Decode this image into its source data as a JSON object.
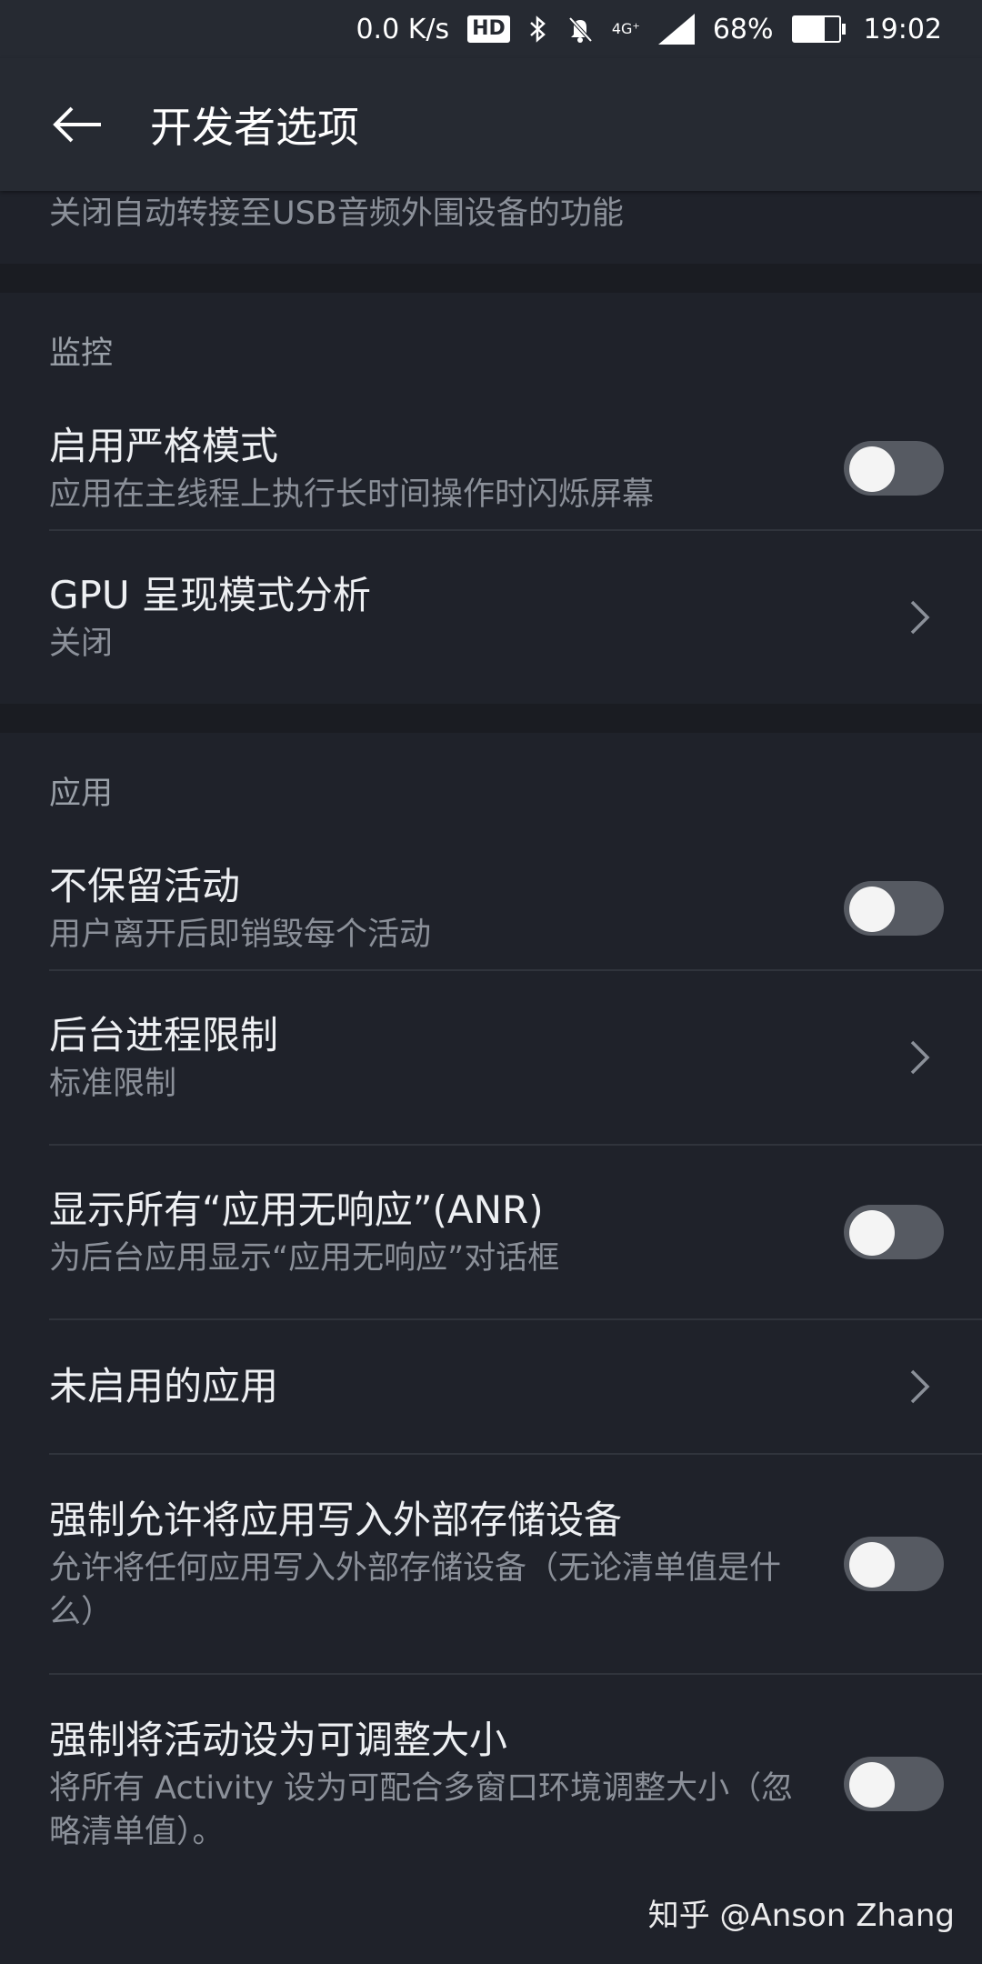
{
  "status_bar": {
    "net_speed": "0.0 K/s",
    "hd_badge": "HD",
    "network_type": "4G⁺",
    "battery_percent": "68%",
    "battery_level": 0.68,
    "time": "19:02"
  },
  "toolbar": {
    "title": "开发者选项"
  },
  "partial_item": {
    "summary": "关闭自动转接至USB音频外围设备的功能",
    "toggle_on": false
  },
  "monitoring": {
    "header": "监控",
    "items": [
      {
        "title": "启用严格模式",
        "summary": "应用在主线程上执行长时间操作时闪烁屏幕",
        "control": "toggle",
        "on": false
      },
      {
        "title": "GPU 呈现模式分析",
        "summary": "关闭",
        "control": "chevron"
      }
    ]
  },
  "apps": {
    "header": "应用",
    "items": [
      {
        "title": "不保留活动",
        "summary": "用户离开后即销毁每个活动",
        "control": "toggle",
        "on": false
      },
      {
        "title": "后台进程限制",
        "summary": "标准限制",
        "control": "chevron"
      },
      {
        "title": "显示所有“应用无响应”(ANR)",
        "summary": "为后台应用显示“应用无响应”对话框",
        "control": "toggle",
        "on": false
      },
      {
        "title": "未启用的应用",
        "summary": "",
        "control": "chevron"
      },
      {
        "title": "强制允许将应用写入外部存储设备",
        "summary": "允许将任何应用写入外部存储设备（无论清单值是什么）",
        "control": "toggle",
        "on": false
      },
      {
        "title": "强制将活动设为可调整大小",
        "summary": "将所有 Activity 设为可配合多窗口环境调整大小（忽略清单值）。",
        "control": "toggle",
        "on": false
      }
    ]
  },
  "watermark": "知乎 @Anson Zhang"
}
